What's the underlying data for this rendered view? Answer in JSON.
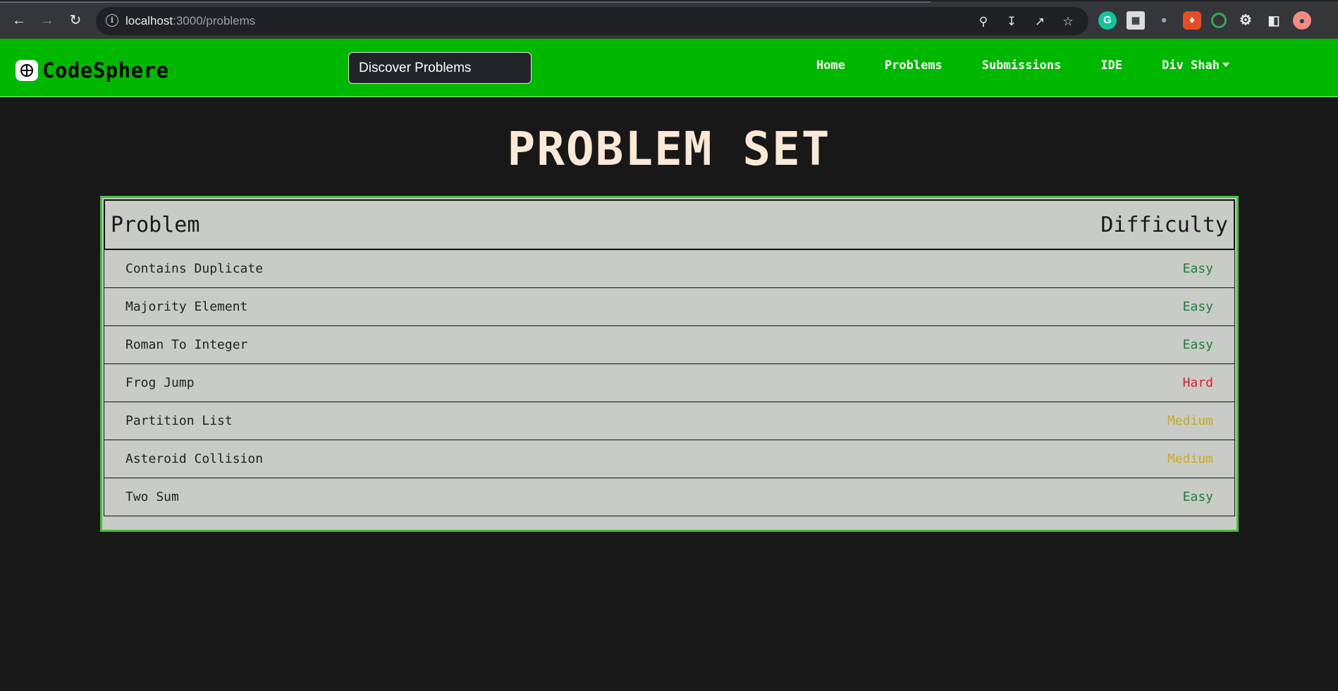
{
  "browser": {
    "url_host": "localhost",
    "url_path": ":3000/problems"
  },
  "navbar": {
    "brand": "CodeSphere",
    "search_value": "Discover Problems",
    "links": [
      {
        "label": "Home"
      },
      {
        "label": "Problems"
      },
      {
        "label": "Submissions"
      },
      {
        "label": "IDE"
      },
      {
        "label": "Div Shah"
      }
    ]
  },
  "main": {
    "title": "PROBLEM SET",
    "columns": {
      "problem": "Problem",
      "difficulty": "Difficulty"
    },
    "problems": [
      {
        "name": "Contains Duplicate",
        "difficulty": "Easy"
      },
      {
        "name": "Majority Element",
        "difficulty": "Easy"
      },
      {
        "name": "Roman To Integer",
        "difficulty": "Easy"
      },
      {
        "name": "Frog Jump",
        "difficulty": "Hard"
      },
      {
        "name": "Partition List",
        "difficulty": "Medium"
      },
      {
        "name": "Asteroid Collision",
        "difficulty": "Medium"
      },
      {
        "name": "Two Sum",
        "difficulty": "Easy"
      }
    ]
  },
  "colors": {
    "navbar_bg": "#00b800",
    "page_bg": "#181818",
    "easy": "#1e7e34",
    "medium": "#c9aa1c",
    "hard": "#e0201f"
  }
}
